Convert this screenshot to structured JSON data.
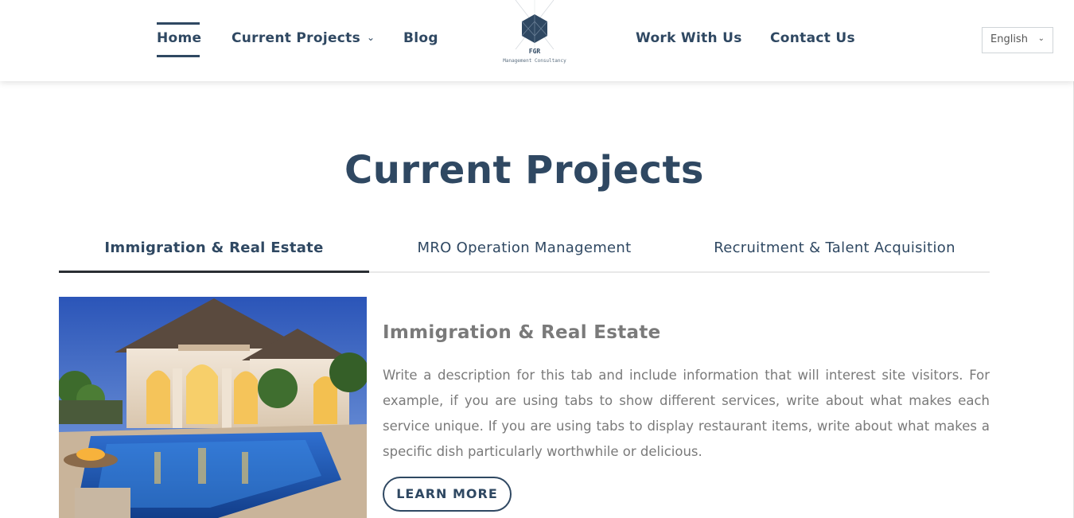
{
  "nav": {
    "home": "Home",
    "current_projects": "Current Projects",
    "blog": "Blog",
    "work_with_us": "Work With Us",
    "contact_us": "Contact Us",
    "chevron_icon": "chevron-down-icon"
  },
  "logo": {
    "name": "FGR",
    "tagline": "Management Consultancy"
  },
  "language": {
    "selected": "English"
  },
  "page": {
    "title": "Current Projects"
  },
  "tabs": [
    {
      "label": "Immigration & Real Estate",
      "active": true
    },
    {
      "label": "MRO Operation Management",
      "active": false
    },
    {
      "label": "Recruitment & Talent Acquisition",
      "active": false
    }
  ],
  "content": {
    "title": "Immigration & Real Estate",
    "description": "Write a description for this tab and include information that will interest site visitors. For example, if you are using tabs to show different services, write about what makes each service unique. If you are using tabs to display restaurant items, write about what makes a specific dish particularly worthwhile or delicious.",
    "button": "LEARN MORE"
  },
  "colors": {
    "brand": "#2f4862",
    "body_text": "#7a7a7a",
    "active_tab_underline": "#2a2e33"
  }
}
